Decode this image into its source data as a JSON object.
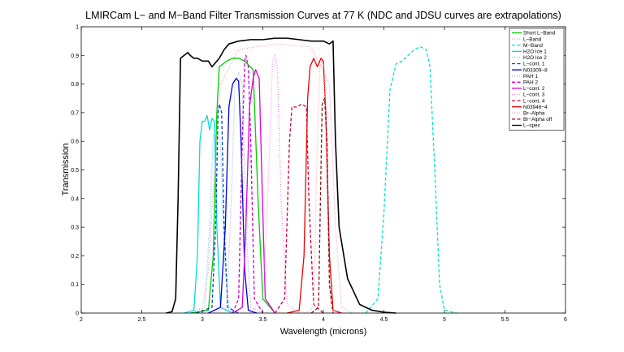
{
  "chart_data": {
    "type": "line",
    "title": "LMIRCam L− and M−Band Filter Transmission Curves at 77 K (NDC and JDSU curves are extrapolations)",
    "xlabel": "Wavelength (microns)",
    "ylabel": "Transmission",
    "xlim": [
      2,
      6
    ],
    "ylim": [
      0,
      1
    ],
    "xticks": [
      2,
      2.5,
      3,
      3.5,
      4,
      4.5,
      5,
      5.5,
      6
    ],
    "yticks": [
      0,
      0.1,
      0.2,
      0.3,
      0.4,
      0.5,
      0.6,
      0.7,
      0.8,
      0.9,
      1
    ],
    "xtick_labels": [
      "2",
      "2.5",
      "3",
      "3.5",
      "4",
      "4.5",
      "5",
      "5.5",
      "6"
    ],
    "ytick_labels": [
      "0",
      "0.1",
      "0.2",
      "0.3",
      "0.4",
      "0.5",
      "0.6",
      "0.7",
      "0.8",
      "0.9",
      "1"
    ],
    "grid": false,
    "legend_position": "top-right",
    "series": [
      {
        "name": "Short L−Band",
        "color": "#00cc00",
        "dash": "solid",
        "points": [
          [
            2.9,
            0
          ],
          [
            3.05,
            0.01
          ],
          [
            3.09,
            0.2
          ],
          [
            3.12,
            0.7
          ],
          [
            3.14,
            0.86
          ],
          [
            3.2,
            0.88
          ],
          [
            3.25,
            0.89
          ],
          [
            3.3,
            0.89
          ],
          [
            3.35,
            0.88
          ],
          [
            3.42,
            0.85
          ],
          [
            3.46,
            0.4
          ],
          [
            3.5,
            0.05
          ],
          [
            3.6,
            0
          ]
        ]
      },
      {
        "name": "L−Band",
        "color": "#ff99cc",
        "dash": "dot",
        "points": [
          [
            2.9,
            0
          ],
          [
            3.0,
            0.02
          ],
          [
            3.05,
            0.15
          ],
          [
            3.1,
            0.5
          ],
          [
            3.15,
            0.8
          ],
          [
            3.3,
            0.92
          ],
          [
            3.6,
            0.94
          ],
          [
            3.9,
            0.93
          ],
          [
            4.05,
            0.8
          ],
          [
            4.1,
            0.3
          ],
          [
            4.15,
            0.02
          ],
          [
            4.25,
            0
          ]
        ]
      },
      {
        "name": "M−Band",
        "color": "#00e6c8",
        "dash": "dash",
        "points": [
          [
            4.35,
            0
          ],
          [
            4.45,
            0.05
          ],
          [
            4.5,
            0.35
          ],
          [
            4.55,
            0.78
          ],
          [
            4.6,
            0.87
          ],
          [
            4.65,
            0.88
          ],
          [
            4.7,
            0.9
          ],
          [
            4.75,
            0.92
          ],
          [
            4.8,
            0.93
          ],
          [
            4.85,
            0.92
          ],
          [
            4.88,
            0.86
          ],
          [
            4.92,
            0.5
          ],
          [
            4.96,
            0.1
          ],
          [
            5.0,
            0.01
          ],
          [
            5.1,
            0
          ]
        ]
      },
      {
        "name": "H2O Ice 1",
        "color": "#00dddd",
        "dash": "solid",
        "points": [
          [
            2.85,
            0
          ],
          [
            2.93,
            0.01
          ],
          [
            2.96,
            0.2
          ],
          [
            2.98,
            0.6
          ],
          [
            3.0,
            0.67
          ],
          [
            3.02,
            0.67
          ],
          [
            3.04,
            0.69
          ],
          [
            3.06,
            0.64
          ],
          [
            3.08,
            0.68
          ],
          [
            3.1,
            0.67
          ],
          [
            3.12,
            0.3
          ],
          [
            3.15,
            0.02
          ],
          [
            3.25,
            0
          ]
        ]
      },
      {
        "name": "H2O Ice 2",
        "color": "#66ccff",
        "dash": "dot",
        "points": [
          [
            2.9,
            0
          ],
          [
            3.02,
            0.02
          ],
          [
            3.06,
            0.3
          ],
          [
            3.09,
            0.62
          ],
          [
            3.12,
            0.64
          ],
          [
            3.15,
            0.6
          ],
          [
            3.18,
            0.2
          ],
          [
            3.22,
            0.01
          ],
          [
            3.3,
            0
          ]
        ]
      },
      {
        "name": "L−cont. 1",
        "color": "#0044cc",
        "dash": "dash",
        "points": [
          [
            2.95,
            0
          ],
          [
            3.08,
            0.02
          ],
          [
            3.11,
            0.3
          ],
          [
            3.13,
            0.7
          ],
          [
            3.14,
            0.73
          ],
          [
            3.16,
            0.7
          ],
          [
            3.18,
            0.3
          ],
          [
            3.21,
            0.02
          ],
          [
            3.3,
            0
          ]
        ]
      },
      {
        "name": "N03309−8",
        "color": "#0000dd",
        "dash": "solid",
        "points": [
          [
            3.05,
            0
          ],
          [
            3.15,
            0.02
          ],
          [
            3.19,
            0.3
          ],
          [
            3.22,
            0.72
          ],
          [
            3.25,
            0.8
          ],
          [
            3.28,
            0.82
          ],
          [
            3.3,
            0.81
          ],
          [
            3.32,
            0.6
          ],
          [
            3.35,
            0.15
          ],
          [
            3.38,
            0.01
          ],
          [
            3.45,
            0
          ]
        ]
      },
      {
        "name": "PAH 1",
        "color": "#aaaaee",
        "dash": "dot",
        "points": [
          [
            3.1,
            0
          ],
          [
            3.2,
            0.02
          ],
          [
            3.24,
            0.4
          ],
          [
            3.27,
            0.8
          ],
          [
            3.3,
            0.84
          ],
          [
            3.33,
            0.8
          ],
          [
            3.36,
            0.3
          ],
          [
            3.4,
            0.02
          ],
          [
            3.5,
            0
          ]
        ]
      },
      {
        "name": "PAH 2",
        "color": "#cc00cc",
        "dash": "dash",
        "points": [
          [
            3.25,
            0
          ],
          [
            3.3,
            0.05
          ],
          [
            3.33,
            0.6
          ],
          [
            3.35,
            0.88
          ],
          [
            3.36,
            0.9
          ],
          [
            3.38,
            0.86
          ],
          [
            3.4,
            0.6
          ],
          [
            3.43,
            0.05
          ],
          [
            3.5,
            0
          ]
        ]
      },
      {
        "name": "L−cont. 2",
        "color": "#dd00dd",
        "dash": "solid",
        "points": [
          [
            3.25,
            0
          ],
          [
            3.33,
            0.02
          ],
          [
            3.36,
            0.3
          ],
          [
            3.39,
            0.72
          ],
          [
            3.42,
            0.82
          ],
          [
            3.44,
            0.85
          ],
          [
            3.47,
            0.82
          ],
          [
            3.49,
            0.5
          ],
          [
            3.52,
            0.05
          ],
          [
            3.6,
            0
          ]
        ]
      },
      {
        "name": "L−cont. 3",
        "color": "#ff88ff",
        "dash": "dot",
        "points": [
          [
            3.4,
            0
          ],
          [
            3.5,
            0.05
          ],
          [
            3.55,
            0.5
          ],
          [
            3.58,
            0.88
          ],
          [
            3.6,
            0.9
          ],
          [
            3.62,
            0.86
          ],
          [
            3.65,
            0.4
          ],
          [
            3.7,
            0.03
          ],
          [
            3.8,
            0
          ]
        ]
      },
      {
        "name": "L−cont. 4",
        "color": "#cc0044",
        "dash": "dash",
        "points": [
          [
            3.6,
            0
          ],
          [
            3.68,
            0.05
          ],
          [
            3.72,
            0.6
          ],
          [
            3.74,
            0.72
          ],
          [
            3.78,
            0.72
          ],
          [
            3.82,
            0.73
          ],
          [
            3.86,
            0.72
          ],
          [
            3.88,
            0.4
          ],
          [
            3.92,
            0.03
          ],
          [
            4.0,
            0
          ]
        ]
      },
      {
        "name": "N03946−4",
        "color": "#ee0000",
        "dash": "solid",
        "points": [
          [
            3.7,
            0
          ],
          [
            3.8,
            0.01
          ],
          [
            3.84,
            0.2
          ],
          [
            3.87,
            0.75
          ],
          [
            3.89,
            0.86
          ],
          [
            3.92,
            0.89
          ],
          [
            3.95,
            0.86
          ],
          [
            3.98,
            0.89
          ],
          [
            4.0,
            0.88
          ],
          [
            4.02,
            0.7
          ],
          [
            4.05,
            0.2
          ],
          [
            4.08,
            0.01
          ],
          [
            4.15,
            0
          ]
        ]
      },
      {
        "name": "Br−Alpha",
        "color": "#ffaaaa",
        "dash": "dot",
        "points": [
          [
            3.85,
            0
          ],
          [
            3.92,
            0.02
          ],
          [
            3.95,
            0.6
          ],
          [
            3.97,
            0.86
          ],
          [
            3.99,
            0.88
          ],
          [
            4.01,
            0.85
          ],
          [
            4.03,
            0.4
          ],
          [
            4.06,
            0.02
          ],
          [
            4.12,
            0
          ]
        ]
      },
      {
        "name": "Br−Alpha off",
        "color": "#881111",
        "dash": "dash",
        "points": [
          [
            3.9,
            0
          ],
          [
            3.96,
            0.02
          ],
          [
            3.98,
            0.5
          ],
          [
            3.99,
            0.73
          ],
          [
            4.01,
            0.75
          ],
          [
            4.03,
            0.6
          ],
          [
            4.05,
            0.1
          ],
          [
            4.08,
            0
          ]
        ]
      },
      {
        "name": "L−spec",
        "color": "#000000",
        "dash": "solid",
        "points": [
          [
            2.7,
            0
          ],
          [
            2.75,
            0.005
          ],
          [
            2.78,
            0.05
          ],
          [
            2.8,
            0.4
          ],
          [
            2.82,
            0.89
          ],
          [
            2.85,
            0.9
          ],
          [
            2.88,
            0.91
          ],
          [
            2.9,
            0.9
          ],
          [
            2.93,
            0.89
          ],
          [
            2.96,
            0.89
          ],
          [
            3.0,
            0.88
          ],
          [
            3.05,
            0.88
          ],
          [
            3.08,
            0.86
          ],
          [
            3.1,
            0.87
          ],
          [
            3.14,
            0.89
          ],
          [
            3.18,
            0.92
          ],
          [
            3.22,
            0.94
          ],
          [
            3.3,
            0.95
          ],
          [
            3.4,
            0.955
          ],
          [
            3.5,
            0.955
          ],
          [
            3.6,
            0.96
          ],
          [
            3.7,
            0.96
          ],
          [
            3.8,
            0.955
          ],
          [
            3.9,
            0.95
          ],
          [
            4.0,
            0.95
          ],
          [
            4.05,
            0.94
          ],
          [
            4.08,
            0.95
          ],
          [
            4.1,
            0.6
          ],
          [
            4.13,
            0.3
          ],
          [
            4.2,
            0.12
          ],
          [
            4.3,
            0.03
          ],
          [
            4.4,
            0.01
          ],
          [
            4.5,
            0.003
          ],
          [
            4.6,
            0
          ]
        ]
      }
    ]
  }
}
